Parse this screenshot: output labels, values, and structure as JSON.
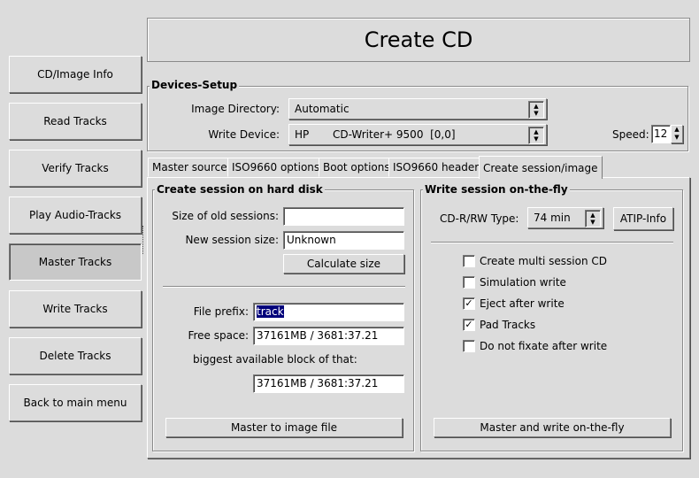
{
  "window": {
    "title": "Create CD"
  },
  "nav": {
    "items": [
      {
        "label": "CD/Image Info"
      },
      {
        "label": "Read Tracks"
      },
      {
        "label": "Verify Tracks"
      },
      {
        "label": "Play Audio-Tracks"
      },
      {
        "label": "Master Tracks",
        "active": true
      },
      {
        "label": "Write Tracks"
      },
      {
        "label": "Delete Tracks"
      },
      {
        "label": "Back to main menu"
      }
    ]
  },
  "devices": {
    "title": "Devices-Setup",
    "image_dir_label": "Image Directory:",
    "image_dir_value": "Automatic",
    "write_device_label": "Write Device:",
    "write_device_value": "HP       CD-Writer+ 9500  [0,0]",
    "speed_label": "Speed:",
    "speed_value": "12"
  },
  "tabs": [
    {
      "label": "Master source"
    },
    {
      "label": "ISO9660 options"
    },
    {
      "label": "Boot options"
    },
    {
      "label": "ISO9660 header"
    },
    {
      "label": "Create session/image",
      "selected": true
    }
  ],
  "hd": {
    "title": "Create session on hard disk",
    "old_size_label": "Size of old sessions:",
    "old_size_value": "",
    "new_size_label": "New session size:",
    "new_size_value": "Unknown",
    "calc_button": "Calculate size",
    "prefix_label": "File prefix:",
    "prefix_value": "track",
    "free_label": "Free space:",
    "free_value": "37161MB / 3681:37.21",
    "biggest_label": "biggest available block of that:",
    "biggest_value": "37161MB / 3681:37.21",
    "master_button": "Master to image file"
  },
  "fly": {
    "title": "Write session on-the-fly",
    "type_label": "CD-R/RW Type:",
    "type_value": "74 min",
    "atip_button": "ATIP-Info",
    "options": [
      {
        "label": "Create multi session CD",
        "checked": false
      },
      {
        "label": "Simulation write",
        "checked": false
      },
      {
        "label": "Eject after write",
        "checked": true
      },
      {
        "label": "Pad Tracks",
        "checked": true
      },
      {
        "label": "Do not fixate after write",
        "checked": false
      }
    ],
    "check_mark": "✓",
    "write_button": "Master and write on-the-fly"
  }
}
